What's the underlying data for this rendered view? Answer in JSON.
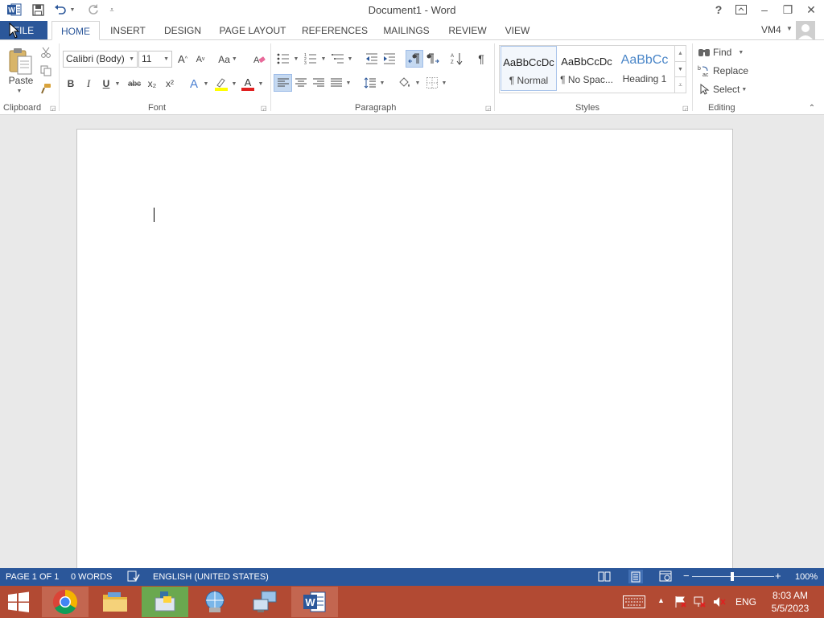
{
  "titlebar": {
    "title": "Document1 - Word",
    "help": "?",
    "minimize": "–",
    "restore": "❐",
    "close": "✕"
  },
  "tabs": {
    "file": "FILE",
    "items": [
      "HOME",
      "INSERT",
      "DESIGN",
      "PAGE LAYOUT",
      "REFERENCES",
      "MAILINGS",
      "REVIEW",
      "VIEW"
    ],
    "active": "HOME",
    "user": "VM4"
  },
  "ribbon": {
    "clipboard": {
      "label": "Clipboard",
      "paste": "Paste"
    },
    "font": {
      "label": "Font",
      "font_name": "Calibri (Body)",
      "font_size": "11",
      "grow": "A",
      "shrink": "A",
      "change_case": "Aa",
      "bold": "B",
      "italic": "I",
      "underline": "U",
      "strike": "abc",
      "subscript": "x₂",
      "superscript": "x²",
      "text_effects": "A",
      "font_color": "A"
    },
    "paragraph": {
      "label": "Paragraph",
      "show_marks": "¶"
    },
    "styles": {
      "label": "Styles",
      "items": [
        {
          "preview": "AaBbCcDc",
          "name": "¶ Normal"
        },
        {
          "preview": "AaBbCcDc",
          "name": "¶ No Spac..."
        },
        {
          "preview": "AaBbCc",
          "name": "Heading 1"
        }
      ]
    },
    "editing": {
      "label": "Editing",
      "find": "Find",
      "replace": "Replace",
      "select": "Select"
    }
  },
  "statusbar": {
    "page": "PAGE 1 OF 1",
    "words": "0 WORDS",
    "language": "ENGLISH (UNITED STATES)",
    "zoom": "100%",
    "zoom_minus": "−",
    "zoom_plus": "+"
  },
  "taskbar": {
    "lang": "ENG",
    "time": "8:03 AM",
    "date": "5/5/2023"
  },
  "colors": {
    "accent": "#2b579a",
    "taskbar": "#b24a33",
    "font_color_bar": "#e02020",
    "highlight_bar": "#ffff00"
  }
}
